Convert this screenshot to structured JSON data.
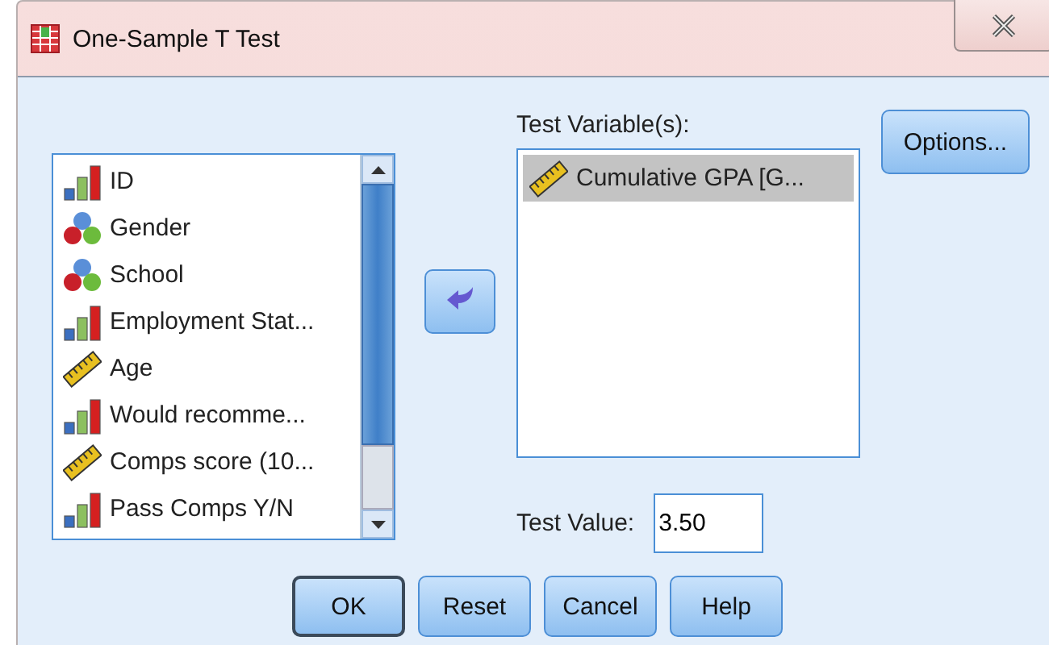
{
  "window": {
    "title": "One-Sample T Test"
  },
  "variables": [
    {
      "name": "ID",
      "kind": "ordinal",
      "selected": false
    },
    {
      "name": "Gender",
      "kind": "nominal",
      "selected": false
    },
    {
      "name": "School",
      "kind": "nominal",
      "selected": false
    },
    {
      "name": "Employment Stat...",
      "kind": "ordinal",
      "selected": false
    },
    {
      "name": "Age",
      "kind": "scale",
      "selected": false
    },
    {
      "name": "Would recomme...",
      "kind": "ordinal",
      "selected": false
    },
    {
      "name": "Comps score (10...",
      "kind": "scale",
      "selected": false
    },
    {
      "name": "Pass Comps Y/N",
      "kind": "ordinal",
      "selected": false
    }
  ],
  "test_variables": {
    "label": "Test Variable(s):",
    "items": [
      {
        "name": "Cumulative GPA [G...",
        "kind": "scale",
        "selected": true
      }
    ]
  },
  "options_button": "Options...",
  "test_value": {
    "label": "Test Value:",
    "value": "3.50"
  },
  "buttons": [
    {
      "label": "OK",
      "default": true
    },
    {
      "label": "Reset",
      "default": false
    },
    {
      "label": "Cancel",
      "default": false
    },
    {
      "label": "Help",
      "default": false
    }
  ]
}
